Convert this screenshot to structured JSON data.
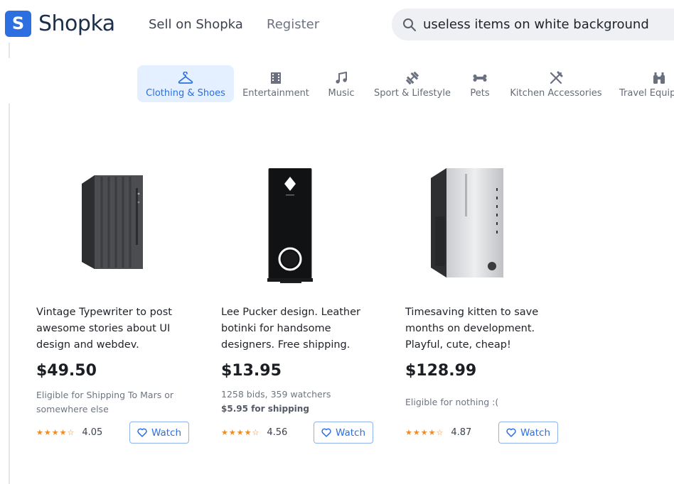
{
  "brand": {
    "badge": "S",
    "name": "Shopka",
    "color": "#2b6fe0"
  },
  "nav": {
    "sell": "Sell on Shopka",
    "register": "Register"
  },
  "search": {
    "value": "useless items on white background",
    "icon": "search-icon"
  },
  "categories": [
    {
      "label": "Clothing & Shoes",
      "icon": "hanger-icon",
      "active": true
    },
    {
      "label": "Entertainment",
      "icon": "film-icon",
      "active": false
    },
    {
      "label": "Music",
      "icon": "music-note-icon",
      "active": false
    },
    {
      "label": "Sport & Lifestyle",
      "icon": "dumbbell-icon",
      "active": false
    },
    {
      "label": "Pets",
      "icon": "bone-icon",
      "active": false
    },
    {
      "label": "Kitchen Accessories",
      "icon": "fork-knife-icon",
      "active": false
    },
    {
      "label": "Travel Equip",
      "icon": "binoculars-icon",
      "active": false
    }
  ],
  "products": [
    {
      "title": "Vintage Typewriter to post awesome stories about UI design and webdev.",
      "price": "$49.50",
      "sub": "Eligible for Shipping To Mars or somewhere else",
      "shipping": "",
      "rating": "4.05",
      "stars": "★★★★☆",
      "watch": "Watch"
    },
    {
      "title": "Lee Pucker design. Leather botinki for handsome designers. Free shipping.",
      "price": "$13.95",
      "sub": "1258 bids, 359 watchers",
      "shipping": "$5.95 for shipping",
      "rating": "4.56",
      "stars": "★★★★☆",
      "watch": "Watch"
    },
    {
      "title": "Timesaving kitten to save months on development. Playful, cute, cheap!",
      "price": "$128.99",
      "sub": "Eligible for nothing :(",
      "shipping": "",
      "rating": "4.87",
      "stars": "★★★★☆",
      "watch": "Watch"
    }
  ]
}
